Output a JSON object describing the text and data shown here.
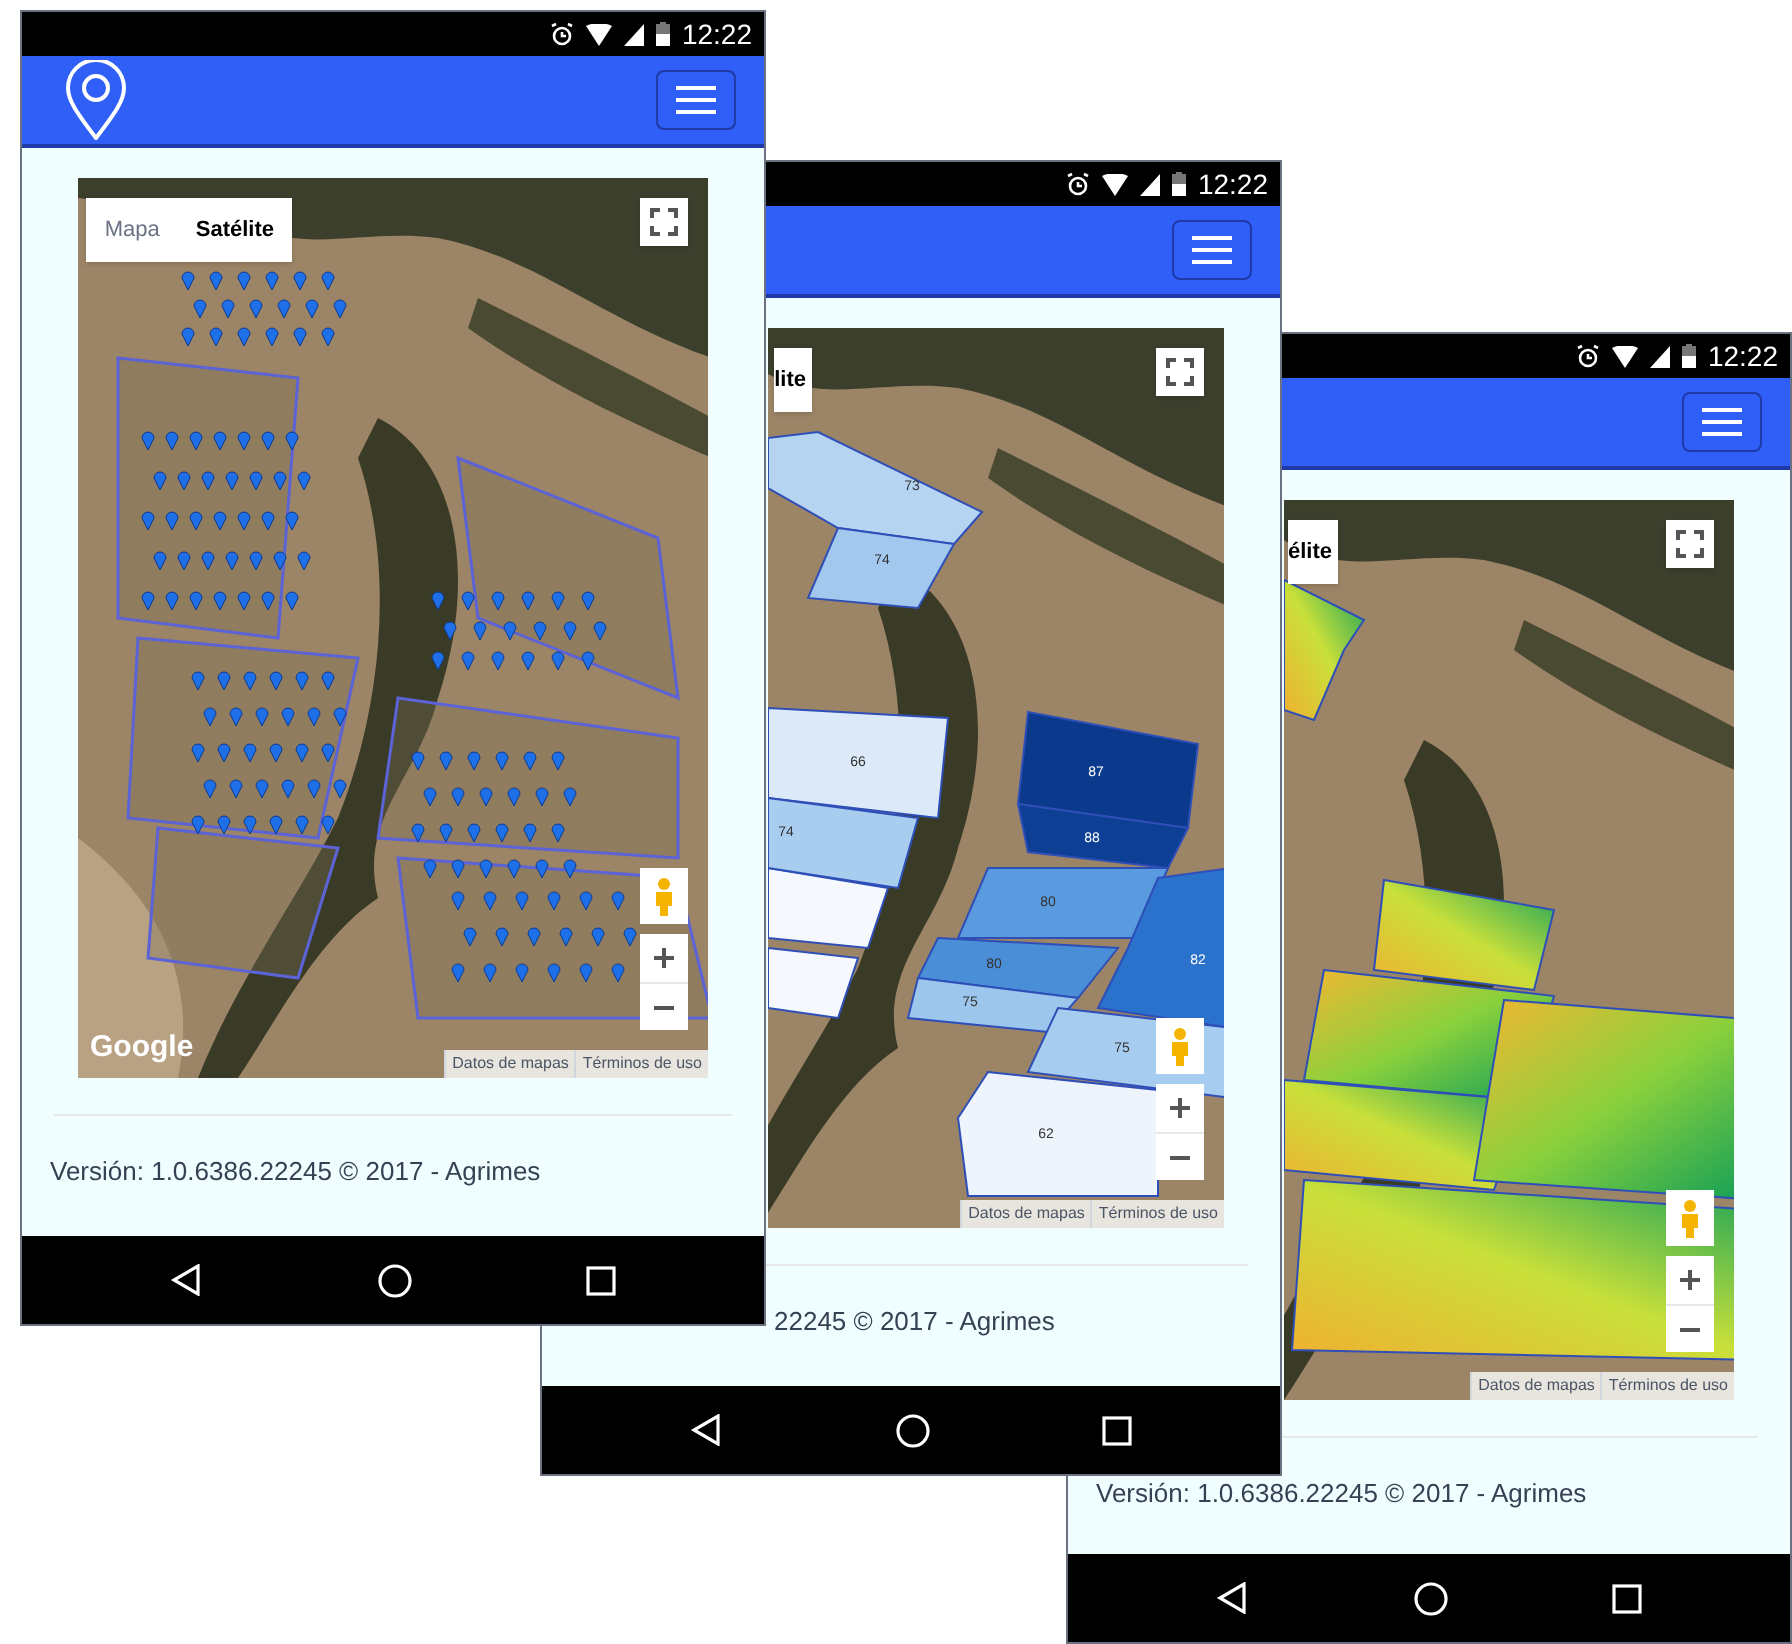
{
  "phones": [
    {
      "kind": "pins",
      "status_bar": {
        "time": "12:22"
      },
      "logo": true,
      "map": {
        "type_tabs": [
          {
            "label": "Mapa",
            "selected": false
          },
          {
            "label": "Satélite",
            "selected": true
          }
        ],
        "google_logo": "Google",
        "attribution": [
          "Datos de mapas",
          "Términos de uso"
        ]
      },
      "footer": "Versión: 1.0.6386.22245 © 2017 - Agrimes"
    },
    {
      "kind": "fields",
      "status_bar": {
        "time": "12:22"
      },
      "map": {
        "type_tabs": [
          {
            "label": "lite",
            "selected": true
          }
        ],
        "fields": [
          {
            "label": "73",
            "color": "#b5d4f2"
          },
          {
            "label": "74",
            "color": "#a3c8ee"
          },
          {
            "label": "66",
            "color": "#dce9f8"
          },
          {
            "label": "74",
            "color": "#a9cdef"
          },
          {
            "label": "87",
            "color": "#0b3a8c"
          },
          {
            "label": "88",
            "color": "#0d3f95"
          },
          {
            "label": "80",
            "color": "#5a9be0"
          },
          {
            "label": "80",
            "color": "#4a8ed8"
          },
          {
            "label": "75",
            "color": "#9dc6ec"
          },
          {
            "label": "82",
            "color": "#2a72cc"
          },
          {
            "label": "75",
            "color": "#a6cdef"
          },
          {
            "label": "62",
            "color": "#eef4fc"
          }
        ],
        "attribution": [
          "Datos de mapas",
          "Términos de uso"
        ]
      },
      "footer": "22245 © 2017 - Agrimes"
    },
    {
      "kind": "heatmap",
      "status_bar": {
        "time": "12:22"
      },
      "map": {
        "type_tabs": [
          {
            "label": "élite",
            "selected": true
          }
        ],
        "attribution": [
          "Datos de mapas",
          "Términos de uso"
        ]
      },
      "footer": "Versión: 1.0.6386.22245 © 2017 - Agrimes"
    }
  ]
}
